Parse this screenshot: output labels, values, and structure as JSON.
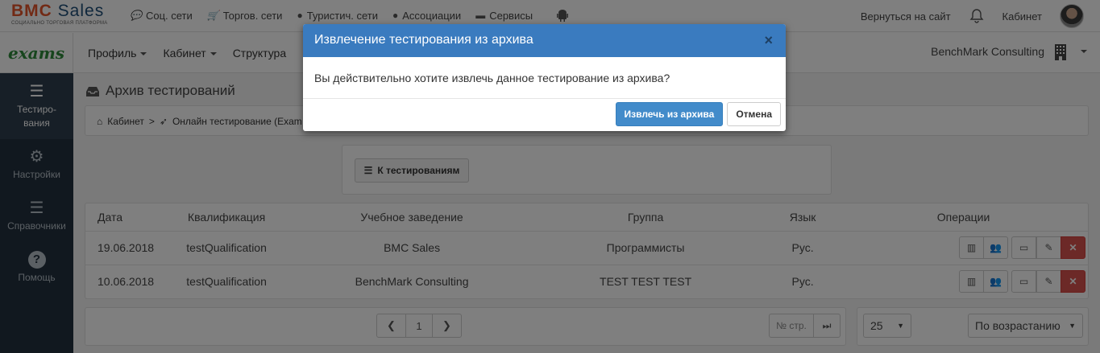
{
  "brand": {
    "logo_bold": "BMC",
    "logo_rest": " Sales",
    "tagline": "СОЦИАЛЬНО ТОРГОВАЯ ПЛАТФОРМА",
    "app_name": "exams"
  },
  "topnav": {
    "items": [
      {
        "label": "Соц. сети",
        "icon": "comment-icon"
      },
      {
        "label": "Торгов. сети",
        "icon": "cart-icon"
      },
      {
        "label": "Туристич. сети",
        "icon": "globe-icon"
      },
      {
        "label": "Ассоциации",
        "icon": "globe-icon"
      },
      {
        "label": "Сервисы",
        "icon": "briefcase-icon"
      }
    ],
    "back_to_site": "Вернуться на сайт",
    "cabinet": "Кабинет"
  },
  "mainnav": {
    "profile": "Профиль",
    "cabinet": "Кабинет",
    "structure": "Структура",
    "company": "BenchMark Consulting"
  },
  "sidebar": {
    "items": [
      {
        "label": "Тестиро-вания",
        "icon": "menu-icon"
      },
      {
        "label": "Настройки",
        "icon": "gear-icon"
      },
      {
        "label": "Справочники",
        "icon": "list-icon"
      },
      {
        "label": "Помощь",
        "icon": "help-icon"
      }
    ]
  },
  "page": {
    "title": "Архив тестирований",
    "breadcrumb": {
      "home": "Кабинет",
      "sep": ">",
      "current": "Онлайн тестирование (Exam"
    },
    "back_button": "К тестированиям"
  },
  "table": {
    "headers": [
      "Дата",
      "Квалификация",
      "Учебное заведение",
      "Группа",
      "Язык",
      "Операции"
    ],
    "rows": [
      [
        "19.06.2018",
        "testQualification",
        "BMC Sales",
        "Программисты",
        "Рус."
      ],
      [
        "10.06.2018",
        "testQualification",
        "BenchMark Consulting",
        "TEST TEST TEST",
        "Рус."
      ]
    ]
  },
  "pagination": {
    "current_page": "1",
    "page_input_placeholder": "№ стр."
  },
  "controls": {
    "page_size": "25",
    "sort": "По возрастанию"
  },
  "modal": {
    "title": "Извлечение тестирования из архива",
    "close": "×",
    "body": "Вы действительно хотите извлечь данное тестирование из архива?",
    "confirm": "Извлечь из архива",
    "cancel": "Отмена"
  },
  "colors": {
    "modal_header": "#3a7bbf",
    "sidebar": "#22313f",
    "danger": "#d9534f",
    "primary": "#428bca",
    "brand_green": "#2e8b3a"
  }
}
